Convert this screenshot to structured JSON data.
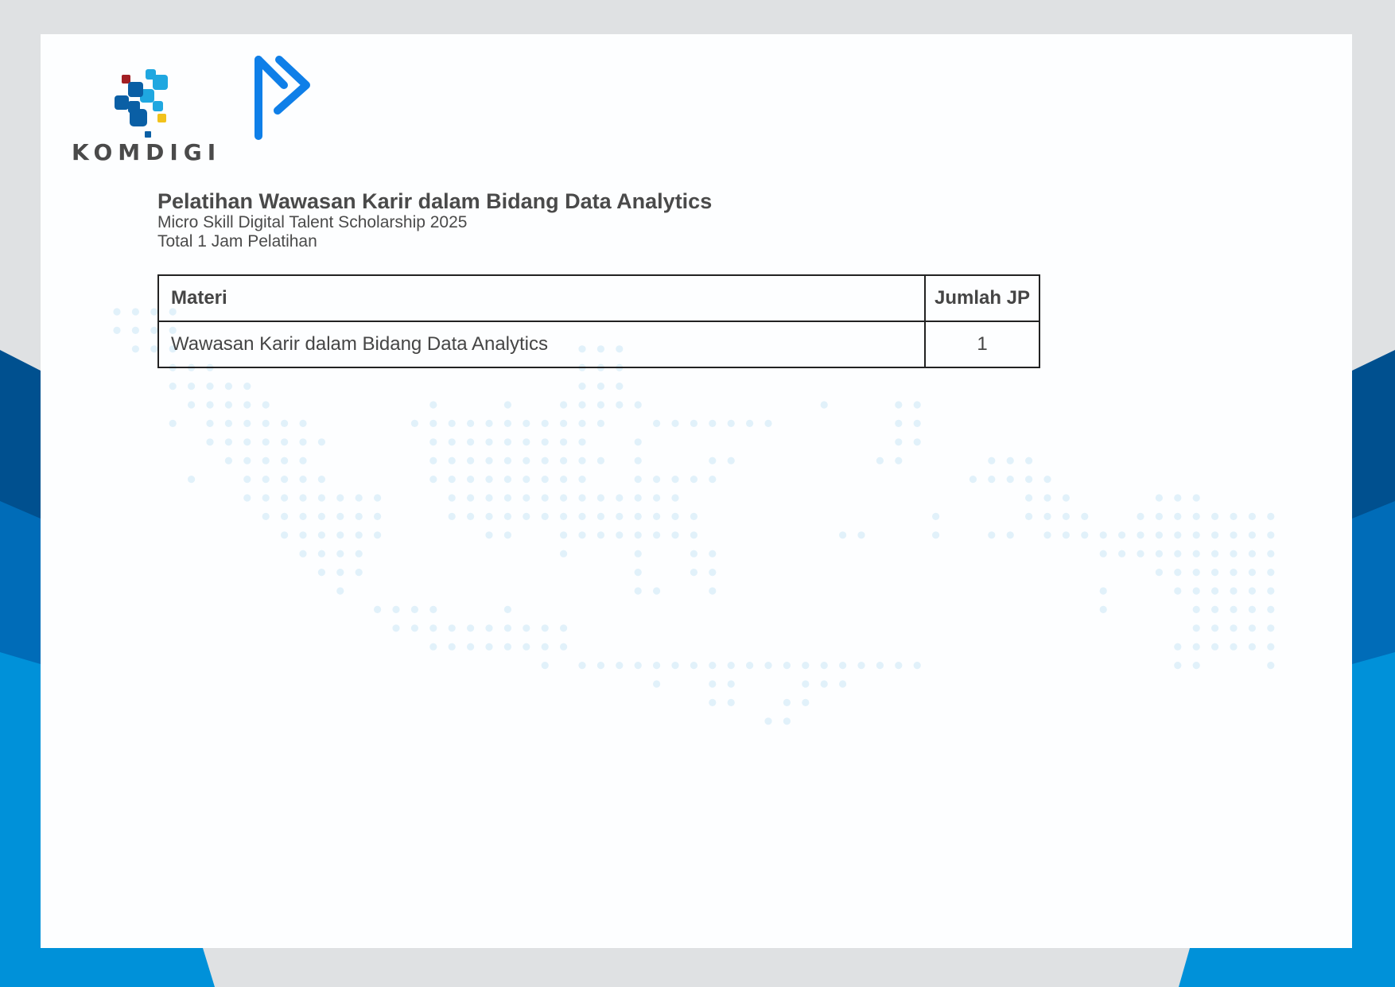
{
  "colors": {
    "page_bg": "#dfe1e3",
    "blue_dark": "#00508f",
    "blue_mid": "#006cb8",
    "blue_light": "#0091d9",
    "text": "#4a4a4a",
    "dot": "#e1f1fa",
    "brand_blue": "#0f7fe8"
  },
  "logos": {
    "komdigi_wordmark": "KOMDIGI",
    "komdigi_icon": "komdigi-pixel-logo",
    "brand_icon": "digital-talent-arrow-logo"
  },
  "certificate": {
    "title": "Pelatihan Wawasan Karir dalam Bidang Data Analytics",
    "program": "Micro Skill Digital Talent Scholarship 2025",
    "total_hours": "Total 1 Jam Pelatihan"
  },
  "table": {
    "headers": {
      "materi": "Materi",
      "jumlah_jp": "Jumlah JP"
    },
    "rows": [
      {
        "materi": "Wawasan Karir dalam Bidang Data Analytics",
        "jumlah_jp": "1"
      }
    ]
  }
}
